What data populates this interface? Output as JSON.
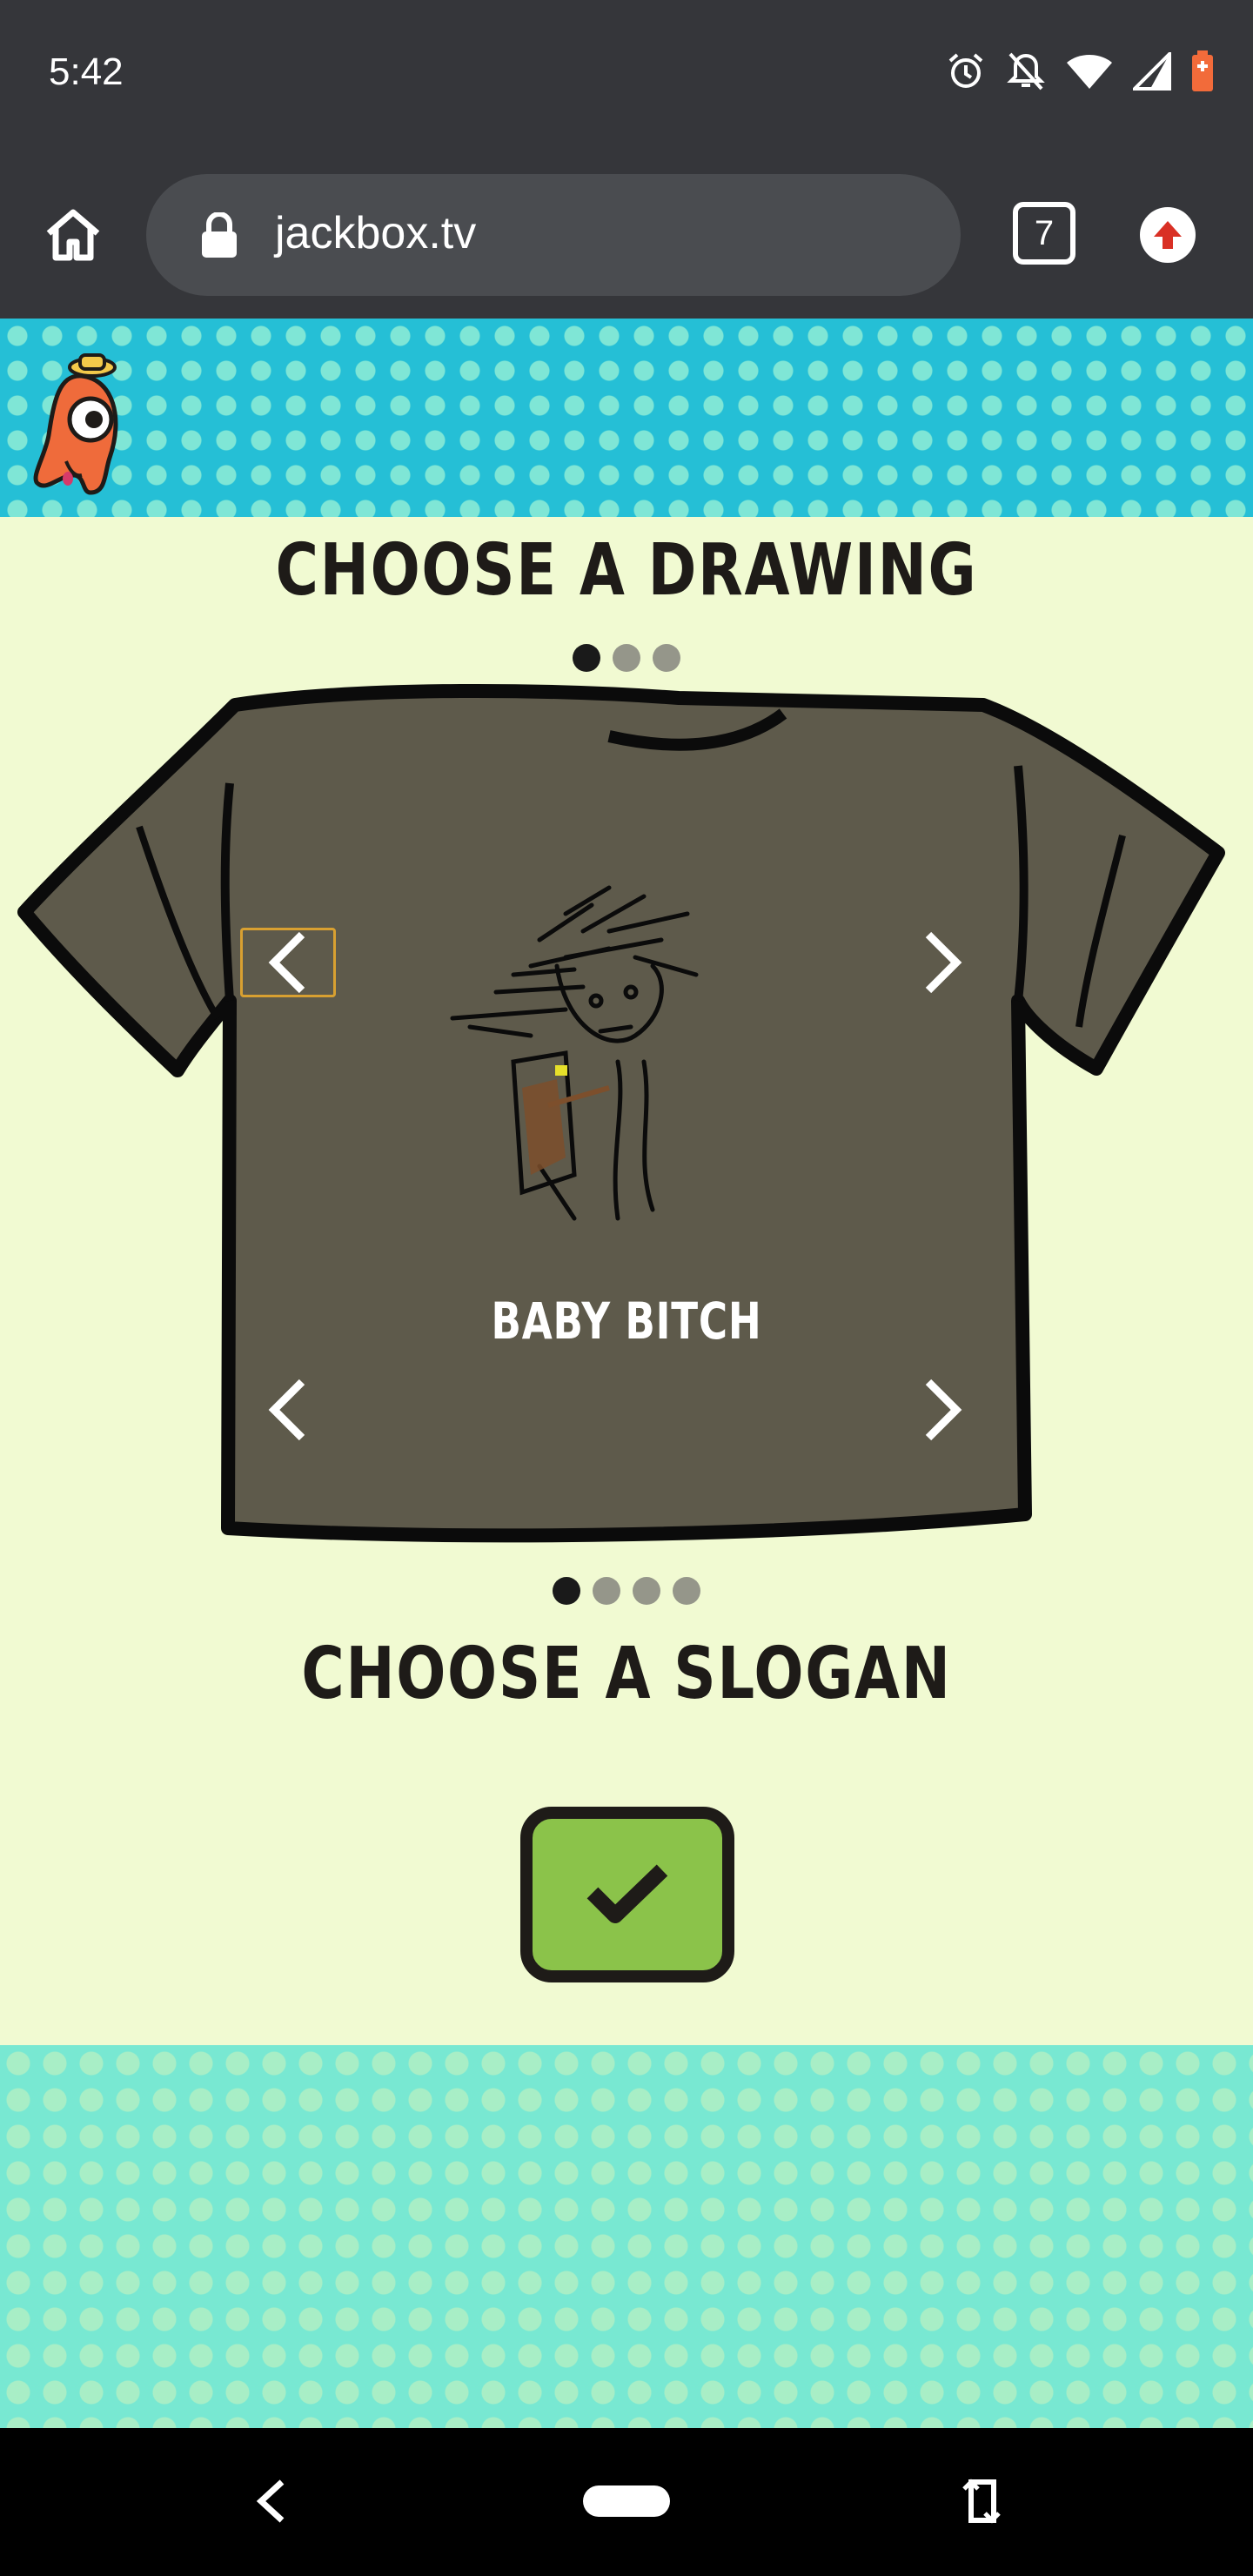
{
  "status_bar": {
    "time": "5:42",
    "icons": [
      "alarm-icon",
      "notifications-off-icon",
      "wifi-icon",
      "cell-signal-icon",
      "battery-icon"
    ]
  },
  "browser": {
    "url": "jackbox.tv",
    "tab_count": "7"
  },
  "game": {
    "drawing_heading": "CHOOSE A DRAWING",
    "slogan_heading": "CHOOSE A SLOGAN",
    "slogan_text": "BABY BITCH",
    "drawing_page_count": 3,
    "drawing_page_active": 1,
    "slogan_page_count": 4,
    "slogan_page_active": 1,
    "shirt_color": "#5e5a4b",
    "submit_color": "#8bc34a"
  },
  "colors": {
    "chrome_bar": "#35363a",
    "page_background": "#f1fad2",
    "header_pattern": "#25bfd6",
    "footer_pattern": "#78e8d2",
    "arrow_focus": "#d8a031"
  }
}
